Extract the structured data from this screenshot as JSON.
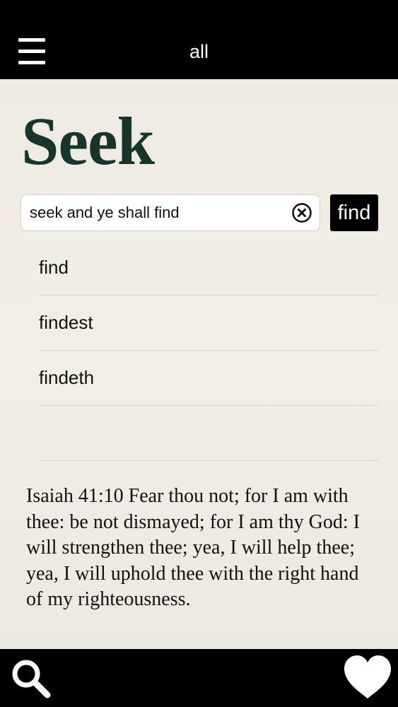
{
  "header": {
    "title": "all",
    "menu_icon": "hamburger-menu-icon"
  },
  "main": {
    "app_title": "Seek",
    "search": {
      "value": "seek and ye shall find",
      "placeholder": "",
      "clear_icon": "clear-circle-x-icon"
    },
    "find_label": "find",
    "suggestions": [
      {
        "label": "find"
      },
      {
        "label": "findest"
      },
      {
        "label": "findeth"
      },
      {
        "label": ""
      }
    ],
    "verse": "Isaiah 41:10 Fear thou not; for I am with thee: be not dismayed; for I am thy God: I will strengthen thee; yea, I will help thee; yea, I will uphold thee with the right hand of my righteousness."
  },
  "footer": {
    "left_icon": "search-icon",
    "right_icon": "heart-icon"
  },
  "colors": {
    "bar_background": "#000000",
    "page_background": "#efece4",
    "title_color": "#16352b"
  }
}
